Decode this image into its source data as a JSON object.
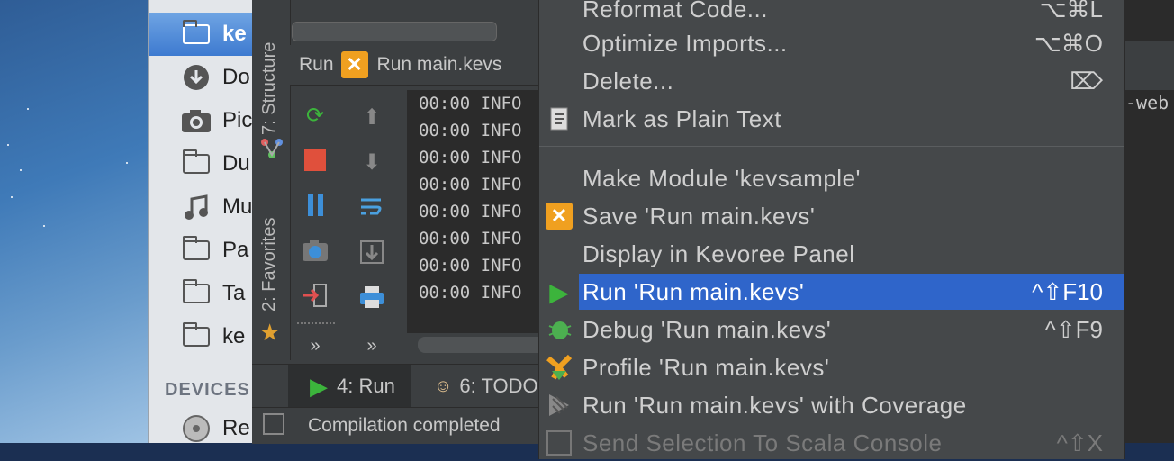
{
  "finder": {
    "items": [
      {
        "label": "ke",
        "icon": "folder-icon",
        "selected": true
      },
      {
        "label": "Do",
        "icon": "downloads-icon"
      },
      {
        "label": "Pic",
        "icon": "camera-icon"
      },
      {
        "label": "Du",
        "icon": "folder-icon"
      },
      {
        "label": "Mu",
        "icon": "music-icon"
      },
      {
        "label": "Pa",
        "icon": "folder-icon"
      },
      {
        "label": "Ta",
        "icon": "folder-icon"
      },
      {
        "label": "ke",
        "icon": "folder-icon"
      }
    ],
    "devices_header": "DEVICES",
    "device_item": "Re"
  },
  "ide": {
    "side_tabs": {
      "structure": "7: Structure",
      "favorites": "2: Favorites"
    },
    "run_bar": {
      "label": "Run",
      "config": "Run main.kevs"
    },
    "console_lines": [
      "00:00 INFO",
      "00:00 INFO",
      "00:00 INFO",
      "00:00 INFO",
      "00:00 INFO",
      "00:00 INFO",
      "00:00 INFO",
      "00:00 INFO"
    ],
    "bottom_tabs": {
      "run": "4: Run",
      "todo": "6: TODO"
    },
    "status": "Compilation completed",
    "right_text": "-web",
    "more_glyph": "»"
  },
  "menu": {
    "items": [
      {
        "label": "Reformat Code...",
        "shortcut": "⌥⌘L",
        "icon": ""
      },
      {
        "label": "Optimize Imports...",
        "shortcut": "⌥⌘O",
        "icon": ""
      },
      {
        "label": "Delete...",
        "shortcut": "⌦",
        "icon": ""
      },
      {
        "label": "Mark as Plain Text",
        "shortcut": "",
        "icon": "plain-text-icon"
      },
      {
        "label": "Make Module 'kevsample'",
        "shortcut": "",
        "icon": ""
      },
      {
        "label": "Save 'Run main.kevs'",
        "shortcut": "",
        "icon": "kevoree-icon"
      },
      {
        "label": "Display in Kevoree Panel",
        "shortcut": "",
        "icon": ""
      },
      {
        "label": "Run 'Run main.kevs'",
        "shortcut": "^⇧F10",
        "icon": "run-icon",
        "selected": true
      },
      {
        "label": "Debug 'Run main.kevs'",
        "shortcut": "^⇧F9",
        "icon": "debug-icon"
      },
      {
        "label": "Profile 'Run main.kevs'",
        "shortcut": "",
        "icon": "profile-icon"
      },
      {
        "label": "Run 'Run main.kevs' with Coverage",
        "shortcut": "",
        "icon": "coverage-icon"
      },
      {
        "label": "Send Selection To Scala Console",
        "shortcut": "^⇧X",
        "icon": "console-icon",
        "disabled": true
      }
    ]
  },
  "colors": {
    "menu_bg": "#45484a",
    "selection": "#2f65ca",
    "ide_bg": "#3c3f41"
  }
}
